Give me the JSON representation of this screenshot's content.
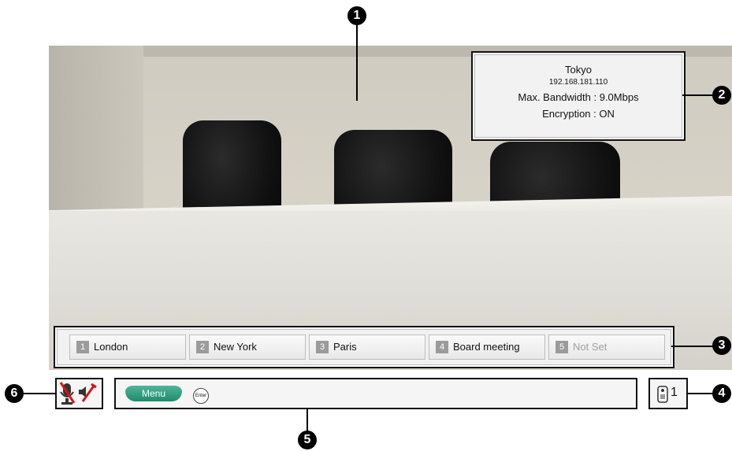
{
  "video": {
    "site_info": {
      "site_name": "Tokyo",
      "ip_address": "192.168.181.110",
      "max_bandwidth": "Max. Bandwidth : 9.0Mbps",
      "encryption": "Encryption : ON"
    }
  },
  "presets": [
    {
      "number": "1",
      "label": "London"
    },
    {
      "number": "2",
      "label": "New York"
    },
    {
      "number": "3",
      "label": "Paris"
    },
    {
      "number": "4",
      "label": "Board meeting"
    },
    {
      "number": "5",
      "label": "Not Set"
    }
  ],
  "status_bar": {
    "menu_label": "Menu",
    "enter_label": "Enter",
    "remote_count": "1"
  },
  "callouts": [
    "1",
    "2",
    "3",
    "4",
    "5",
    "6"
  ]
}
